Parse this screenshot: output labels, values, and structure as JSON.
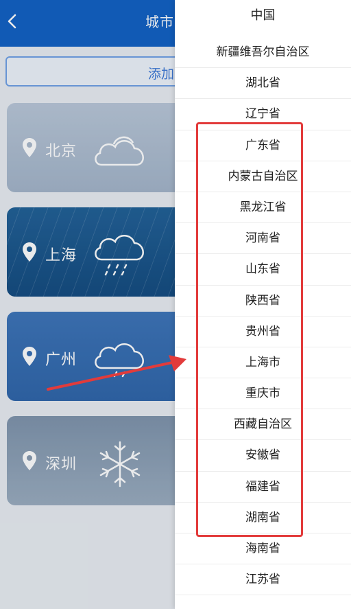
{
  "header": {
    "back_icon": "chevron-left-icon",
    "title": "城市"
  },
  "add_button": {
    "label": "添加"
  },
  "cards": [
    {
      "city": "北京",
      "weather_icon": "cloud-icon"
    },
    {
      "city": "上海",
      "weather_icon": "rain-cloud-icon"
    },
    {
      "city": "广州",
      "weather_icon": "rain-cloud-icon"
    },
    {
      "city": "深圳",
      "weather_icon": "snowflake-icon"
    }
  ],
  "drawer": {
    "title": "中国",
    "items": [
      "新疆维吾尔自治区",
      "湖北省",
      "辽宁省",
      "广东省",
      "内蒙古自治区",
      "黑龙江省",
      "河南省",
      "山东省",
      "陕西省",
      "贵州省",
      "上海市",
      "重庆市",
      "西藏自治区",
      "安徽省",
      "福建省",
      "湖南省",
      "海南省",
      "江苏省"
    ]
  },
  "colors": {
    "topbar": "#0f5fc3",
    "highlight_box": "#e23b3b",
    "arrow": "#e23b3b"
  }
}
